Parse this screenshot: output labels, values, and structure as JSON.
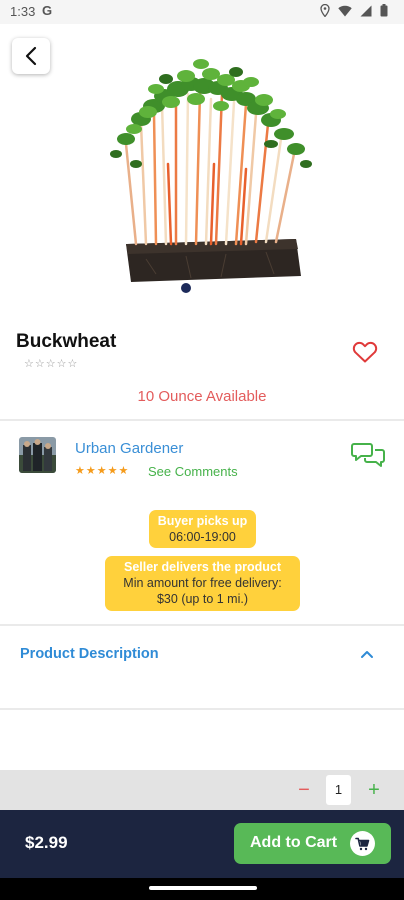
{
  "status_bar": {
    "time": "1:33",
    "g_label": "G"
  },
  "product": {
    "name": "Buckwheat",
    "empty_stars": "☆☆☆☆☆",
    "availability": "10 Ounce Available"
  },
  "seller": {
    "name": "Urban Gardener",
    "stars": "★★★★★",
    "see_comments": "See Comments"
  },
  "badges": {
    "pickup_title": "Buyer picks up",
    "pickup_time": "06:00-19:00",
    "delivery_title": "Seller delivers the product",
    "delivery_line1": "Min amount for free delivery:",
    "delivery_line2": "$30 (up to 1 mi.)"
  },
  "description": {
    "title": "Product Description"
  },
  "quantity": {
    "minus": "−",
    "value": "1",
    "plus": "+"
  },
  "footer": {
    "price": "$2.99",
    "add_to_cart": "Add to Cart"
  },
  "colors": {
    "accent_blue": "#2f8bd6",
    "green": "#58b957",
    "red": "#e35c5c",
    "yellow": "#ffd13c",
    "navy": "#1c2540"
  },
  "icons": [
    "back-arrow-icon",
    "heart-icon",
    "chat-icon",
    "chevron-up-icon",
    "cart-icon"
  ]
}
